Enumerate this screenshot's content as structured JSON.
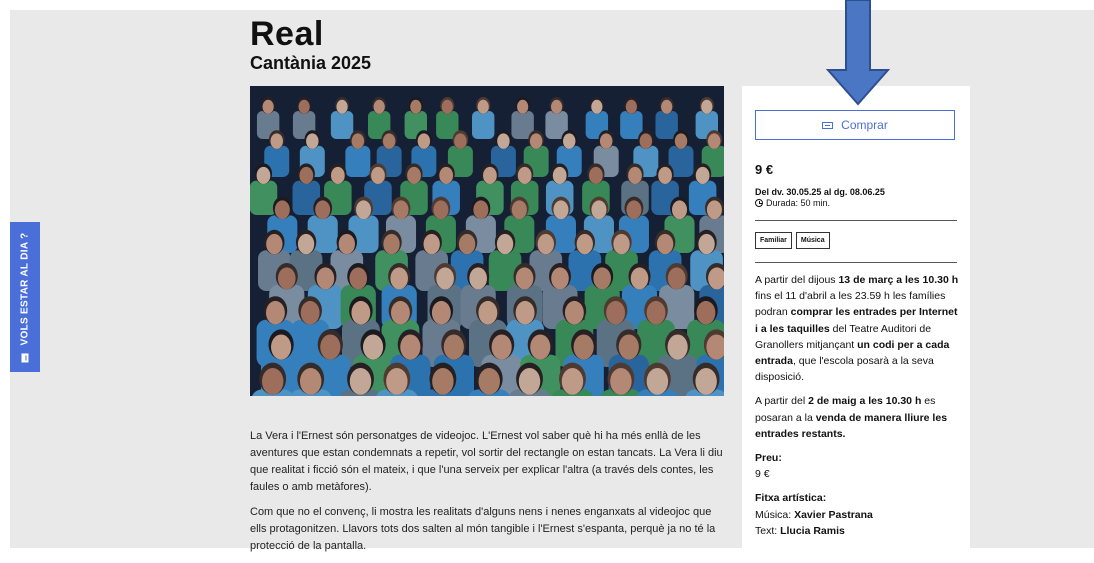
{
  "sidebar_tab": {
    "label": "VOLS ESTAR AL DIA ?"
  },
  "event": {
    "title": "Real",
    "subtitle": "Cantània 2025"
  },
  "purchase": {
    "buy_label": "Comprar",
    "price": "9 €",
    "dates": "Del dv. 30.05.25 al dg. 08.06.25",
    "duration": "Durada: 50 min."
  },
  "tags": [
    "Familiar",
    "Música"
  ],
  "info": {
    "p1": {
      "a": "A partir del dijous ",
      "b": "13 de març a les 10.30 h",
      "c": " fins el 11 d'abril a les 23.59 h les famílies podran ",
      "d": "comprar les entrades per Internet i a les taquilles",
      "e": " del Teatre Auditori de Granollers mitjançant ",
      "f": "un codi per a cada entrada",
      "g": ", que l'escola posarà a la seva disposició."
    },
    "p2": {
      "a": "A partir del ",
      "b": "2 de maig a les 10.30 h",
      "c": " es posaran a la ",
      "d": "venda de manera lliure les entrades restants."
    },
    "preu": {
      "label": "Preu:",
      "value": "9 €"
    },
    "fitxa": {
      "label": "Fitxa artística:",
      "musica_label": "Música: ",
      "musica_value": "Xavier Pastrana",
      "text_label": "Text: ",
      "text_value": "Llucia Ramis"
    }
  },
  "description": {
    "p1": "La Vera i l'Ernest són personatges de videojoc. L'Ernest vol saber què hi ha més enllà de les aventures que estan condemnats a repetir, vol sortir del rectangle on estan tancats. La Vera li diu que realitat i ficció són el mateix, i que l'una serveix per explicar l'altra (a través dels contes, les faules o amb metàfores).",
    "p2": "Com que no el convenç, li mostra les realitats d'alguns nens i nenes enganxats al videojoc que ells protagonitzen. Llavors tots dos salten al món tangible i l'Ernest s'espanta, perquè ja no té la protecció de la pantalla."
  },
  "colors": {
    "accent": "#4b6fd8",
    "arrow_fill": "#4a76c4",
    "arrow_stroke": "#2e4f8e",
    "page_bg": "#e9e9e9",
    "photo_bg": "#151b2a"
  }
}
